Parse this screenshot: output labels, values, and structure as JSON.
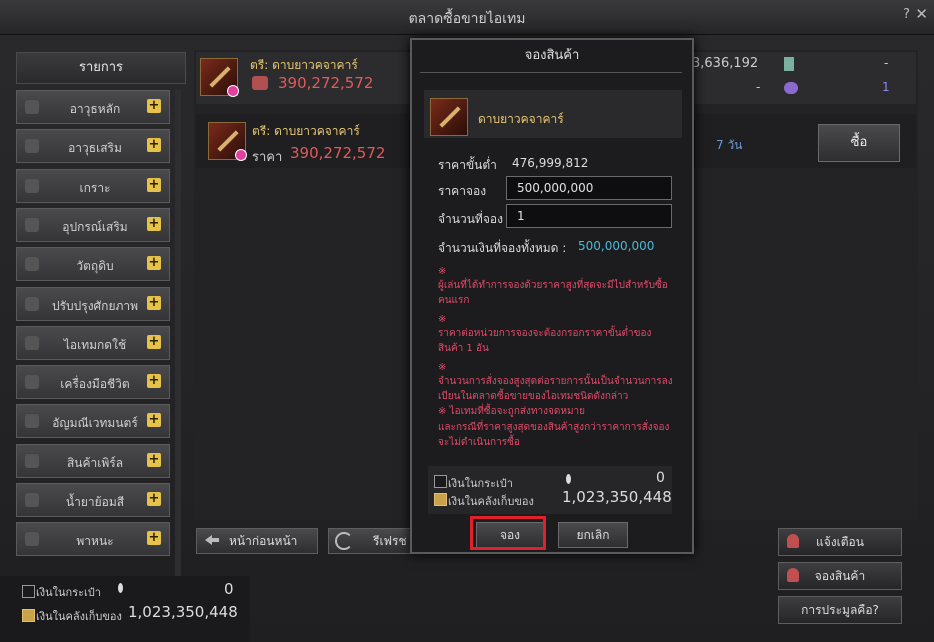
{
  "window": {
    "title": "ตลาดซื้อขายไอเทม",
    "help": "?",
    "close": "✕"
  },
  "sidebar": {
    "header": "รายการ",
    "items": [
      {
        "label": "อาวุธหลัก"
      },
      {
        "label": "อาวุธเสริม"
      },
      {
        "label": "เกราะ"
      },
      {
        "label": "อุปกรณ์เสริม"
      },
      {
        "label": "วัตถุดิบ"
      },
      {
        "label": "ปรับปรุงศักยภาพ"
      },
      {
        "label": "ไอเทมกดใช้"
      },
      {
        "label": "เครื่องมือชีวิต"
      },
      {
        "label": "อัญมณีเวทมนตร์"
      },
      {
        "label": "สินค้าเพิร์ล"
      },
      {
        "label": "น้ำยาย้อมสี"
      },
      {
        "label": "พาหนะ"
      }
    ],
    "plus": "+"
  },
  "listing_top": {
    "name": "ตรี: ดาบยาวคจาคาร์",
    "price": "390,272,572",
    "right_value": "3,636,192",
    "right_dash": "-",
    "right_dash2": "-",
    "right_count": "1"
  },
  "listing_row": {
    "name": "ตรี: ดาบยาวคจาคาร์",
    "price_label": "ราคา",
    "price": "390,272,572",
    "duration": "7 วัน",
    "buy": "ซื้อ"
  },
  "nav": {
    "prev": "หน้าก่อนหน้า",
    "refresh": "รีเฟรช"
  },
  "right_buttons": {
    "alert": "แจ้งเตือน",
    "reserve": "จองสินค้า",
    "auction": "การประมูลคือ?"
  },
  "wallet": {
    "inventory_label": "เงินในกระเป๋า",
    "inventory_value": "0",
    "storage_label": "เงินในคลังเก็บของ",
    "storage_value": "1,023,350,448"
  },
  "dialog": {
    "title": "จองสินค้า",
    "item_name": "ดาบยาวคจาคาร์",
    "min_price_label": "ราคาขั้นต่ำ",
    "min_price": "476,999,812",
    "reserve_price_label": "ราคาจอง",
    "reserve_price": "500,000,000",
    "qty_label": "จำนวนที่จอง",
    "qty": "1",
    "total_label": "จำนวนเงินที่จองทั้งหมด :",
    "total": "500,000,000",
    "notes": [
      "※",
      "ผู้เล่นที่ได้ทำการจองด้วยราคาสูงที่สุดจะมีไปสำหรับซื้อคนแรก",
      "※",
      "ราคาต่อหน่วยการจองจะต้องกรอกราคาขั้นต่ำของสินค้า 1 อัน",
      "※",
      "จำนวนการสั่งจองสูงสุดต่อรายการนั้นเป็นจำนวนการลงเบียนในตลาดซื้อขายของไอเทมชนิดดังกล่าว",
      "※ ไอเทมที่ซื้อจะถูกส่งทางจดหมาย",
      "และกรณีที่ราคาสูงสุดของสินค้าสูงกว่าราคาการสั่งจอง จะไม่ดำเนินการซื้อ"
    ],
    "inventory_label": "เงินในกระเป๋า",
    "inventory_value": "0",
    "storage_label": "เงินในคลังเก็บของ",
    "storage_value": "1,023,350,448",
    "confirm": "จอง",
    "cancel": "ยกเลิก"
  }
}
